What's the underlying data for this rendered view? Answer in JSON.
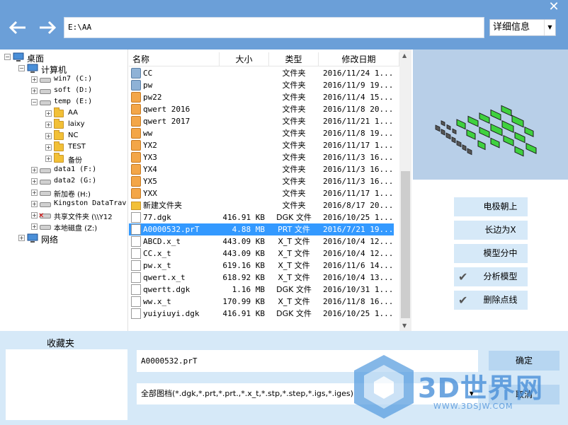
{
  "window": {
    "close_glyph": "✕"
  },
  "toolbar": {
    "path": "E:\\AA",
    "view_mode": "详细信息"
  },
  "tree": {
    "items": [
      {
        "label": "桌面",
        "icon": "desktop-icon"
      },
      {
        "label": "计算机",
        "icon": "computer-icon"
      },
      {
        "label": "win7 (C:)",
        "icon": "drive-icon"
      },
      {
        "label": "soft (D:)",
        "icon": "drive-icon"
      },
      {
        "label": "temp (E:)",
        "icon": "drive-icon"
      },
      {
        "label": "AA",
        "icon": "folder-icon"
      },
      {
        "label": "laixy",
        "icon": "folder-icon"
      },
      {
        "label": "NC",
        "icon": "folder-icon"
      },
      {
        "label": "TEST",
        "icon": "folder-icon"
      },
      {
        "label": "备份",
        "icon": "folder-icon"
      },
      {
        "label": "data1 (F:)",
        "icon": "drive-icon"
      },
      {
        "label": "data2 (G:)",
        "icon": "drive-icon"
      },
      {
        "label": "新加卷 (H:)",
        "icon": "drive-icon"
      },
      {
        "label": "Kingston DataTrav",
        "icon": "usb-drive-icon"
      },
      {
        "label": "共享文件夹 (\\\\Y12",
        "icon": "network-drive-icon"
      },
      {
        "label": "本地磁盘 (Z:)",
        "icon": "drive-icon"
      },
      {
        "label": "网络",
        "icon": "network-icon"
      }
    ]
  },
  "filelist": {
    "headers": {
      "name": "名称",
      "size": "大小",
      "type": "类型",
      "date": "修改日期"
    },
    "rows": [
      {
        "name": "CC",
        "size": "",
        "type": "文件夹",
        "date": "2016/11/24 1...",
        "icon": "app-folder-alt"
      },
      {
        "name": "pw",
        "size": "",
        "type": "文件夹",
        "date": "2016/11/9 19...",
        "icon": "app-folder-alt"
      },
      {
        "name": "pw22",
        "size": "",
        "type": "文件夹",
        "date": "2016/11/4 15...",
        "icon": "app-folder"
      },
      {
        "name": "qwert 2016",
        "size": "",
        "type": "文件夹",
        "date": "2016/11/8 20...",
        "icon": "app-folder"
      },
      {
        "name": "qwert 2017",
        "size": "",
        "type": "文件夹",
        "date": "2016/11/21 1...",
        "icon": "app-folder"
      },
      {
        "name": "ww",
        "size": "",
        "type": "文件夹",
        "date": "2016/11/8 19...",
        "icon": "app-folder"
      },
      {
        "name": "YX2",
        "size": "",
        "type": "文件夹",
        "date": "2016/11/17 1...",
        "icon": "app-folder"
      },
      {
        "name": "YX3",
        "size": "",
        "type": "文件夹",
        "date": "2016/11/3 16...",
        "icon": "app-folder"
      },
      {
        "name": "YX4",
        "size": "",
        "type": "文件夹",
        "date": "2016/11/3 16...",
        "icon": "app-folder"
      },
      {
        "name": "YX5",
        "size": "",
        "type": "文件夹",
        "date": "2016/11/3 16...",
        "icon": "app-folder"
      },
      {
        "name": "YXX",
        "size": "",
        "type": "文件夹",
        "date": "2016/11/17 1...",
        "icon": "app-folder"
      },
      {
        "name": "新建文件夹",
        "size": "",
        "type": "文件夹",
        "date": "2016/8/17 20...",
        "icon": "plain-folder"
      },
      {
        "name": "77.dgk",
        "size": "416.91 KB",
        "type": "DGK 文件",
        "date": "2016/10/25 1...",
        "icon": "doc"
      },
      {
        "name": "A0000532.prT",
        "size": "4.88 MB",
        "type": "PRT 文件",
        "date": "2016/7/21 19...",
        "icon": "doc"
      },
      {
        "name": "ABCD.x_t",
        "size": "443.09 KB",
        "type": "X_T 文件",
        "date": "2016/10/4 12...",
        "icon": "doc"
      },
      {
        "name": "CC.x_t",
        "size": "443.09 KB",
        "type": "X_T 文件",
        "date": "2016/10/4 12...",
        "icon": "doc"
      },
      {
        "name": "pw.x_t",
        "size": "619.16 KB",
        "type": "X_T 文件",
        "date": "2016/11/6 14...",
        "icon": "doc"
      },
      {
        "name": "qwert.x_t",
        "size": "618.92 KB",
        "type": "X_T 文件",
        "date": "2016/10/4 13...",
        "icon": "doc"
      },
      {
        "name": "qwertt.dgk",
        "size": "1.16 MB",
        "type": "DGK 文件",
        "date": "2016/10/31 1...",
        "icon": "doc"
      },
      {
        "name": "ww.x_t",
        "size": "170.99 KB",
        "type": "X_T 文件",
        "date": "2016/11/8 16...",
        "icon": "doc"
      },
      {
        "name": "yuiyiuyi.dgk",
        "size": "416.91 KB",
        "type": "DGK 文件",
        "date": "2016/10/25 1...",
        "icon": "doc"
      }
    ],
    "selected_index": 13
  },
  "options": [
    {
      "label": "电极朝上",
      "checked": false
    },
    {
      "label": "长边为X",
      "checked": false
    },
    {
      "label": "模型分中",
      "checked": false
    },
    {
      "label": "分析模型",
      "checked": true
    },
    {
      "label": "删除点线",
      "checked": true
    }
  ],
  "bottom": {
    "favorites_title": "收藏夹",
    "filename": "A0000532.prT",
    "filter": "全部图档(*.dgk,*.prt,*.prt.,*.x_t,*.stp,*.step,*.igs,*.iges)",
    "ok_label": "确定",
    "cancel_label": "取消"
  },
  "watermark": {
    "text": "3D世界网",
    "url": "WWW.3DSJW.COM"
  },
  "colors": {
    "topbar": "#6b9fd8",
    "selection": "#3399ff",
    "bottom_bg": "#d6e9f8",
    "button_bg": "#b7d6f1",
    "preview_bg": "#b8cfe8"
  }
}
